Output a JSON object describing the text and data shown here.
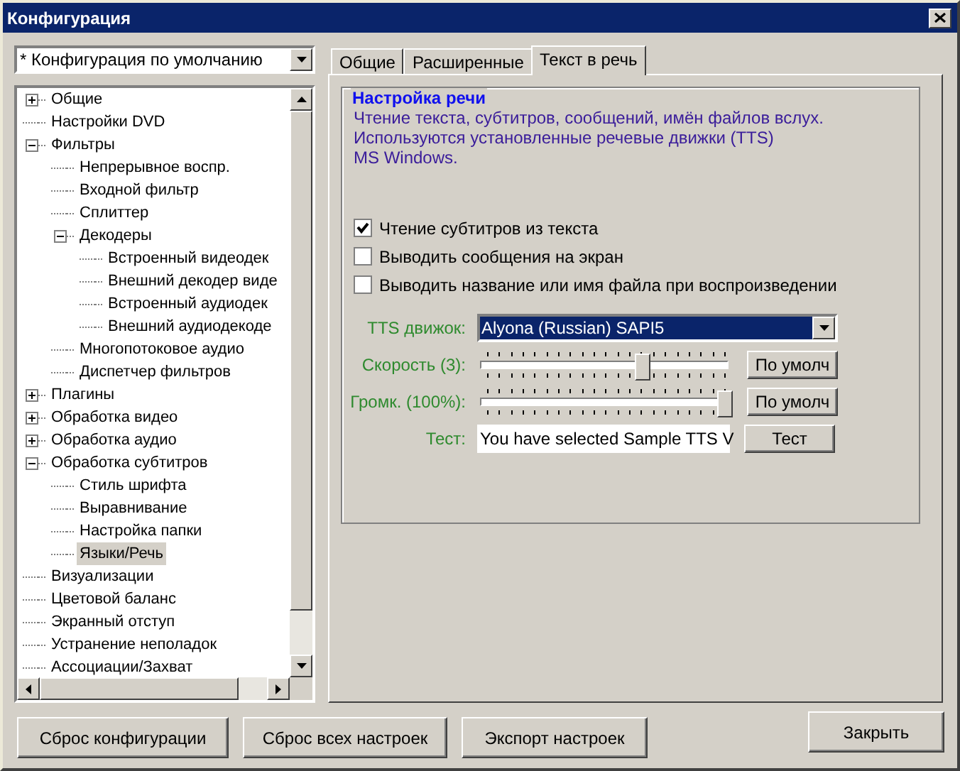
{
  "window": {
    "title": "Конфигурация"
  },
  "profile": {
    "value": "* Конфигурация по умолчанию"
  },
  "tree": {
    "items": [
      {
        "label": "Общие",
        "selected": false,
        "expanded": false
      },
      {
        "label": "Настройки DVD",
        "selected": false
      },
      {
        "label": "Фильтры",
        "selected": false,
        "expanded": true,
        "children": [
          {
            "label": "Непрерывное воспр.",
            "selected": false
          },
          {
            "label": "Входной фильтр",
            "selected": false
          },
          {
            "label": "Сплиттер",
            "selected": false
          },
          {
            "label": "Декодеры",
            "selected": false,
            "expanded": true,
            "children": [
              {
                "label": "Встроенный видеодек",
                "selected": false
              },
              {
                "label": "Внешний декодер виде",
                "selected": false
              },
              {
                "label": "Встроенный аудиодек",
                "selected": false
              },
              {
                "label": "Внешний аудиодекоде",
                "selected": false
              }
            ]
          },
          {
            "label": "Многопотоковое аудио",
            "selected": false
          },
          {
            "label": "Диспетчер фильтров",
            "selected": false
          }
        ]
      },
      {
        "label": "Плагины",
        "selected": false,
        "expanded": false
      },
      {
        "label": "Обработка видео",
        "selected": false,
        "expanded": false
      },
      {
        "label": "Обработка аудио",
        "selected": false,
        "expanded": false
      },
      {
        "label": "Обработка субтитров",
        "selected": false,
        "expanded": true,
        "children": [
          {
            "label": "Стиль шрифта",
            "selected": false
          },
          {
            "label": "Выравнивание",
            "selected": false
          },
          {
            "label": "Настройка папки",
            "selected": false
          },
          {
            "label": "Языки/Речь",
            "selected": true
          }
        ]
      },
      {
        "label": "Визуализации",
        "selected": false
      },
      {
        "label": "Цветовой баланс",
        "selected": false
      },
      {
        "label": "Экранный отступ",
        "selected": false
      },
      {
        "label": "Устранение неполадок",
        "selected": false
      },
      {
        "label": "Ассоциации/Захват",
        "selected": false
      }
    ]
  },
  "tabs": [
    {
      "label": "Общие",
      "selected": false
    },
    {
      "label": "Расширенные",
      "selected": false
    },
    {
      "label": "Текст в речь",
      "selected": true
    }
  ],
  "group": {
    "title": "Настройка речи",
    "description": "Чтение текста, субтитров, сообщений, имён файлов вслух.\nИспользуются установленные речевые движки (TTS)\nMS Windows."
  },
  "checkboxes": [
    {
      "label": "Чтение субтитров из текста",
      "checked": true
    },
    {
      "label": "Выводить сообщения на экран",
      "checked": false
    },
    {
      "label": "Выводить название или имя файла при воспроизведении",
      "checked": false
    }
  ],
  "settings": [
    {
      "kind": "select",
      "label": "TTS движок:",
      "value": "Alyona (Russian) SAPI5"
    },
    {
      "kind": "slider",
      "label": "Скорость (3):",
      "level": 0.65,
      "button": "По умолч"
    },
    {
      "kind": "slider",
      "label": "Громк. (100%):",
      "level": 1,
      "button": "По умолч"
    },
    {
      "kind": "text",
      "label": "Тест:",
      "value": "You have selected Sample TTS V",
      "button": "Тест"
    }
  ],
  "buttons": [
    "Сброс конфигурации",
    "Сброс всех настроек",
    "Экспорт настроек"
  ],
  "close_button": "Закрыть"
}
